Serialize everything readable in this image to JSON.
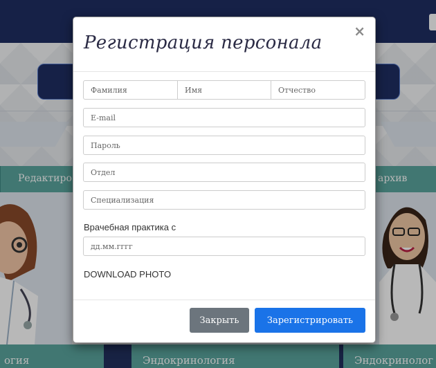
{
  "background": {
    "nav_left": "Редактиро",
    "nav_right": "архив",
    "footer_left": "огия",
    "footer_middle": "Эндокринология",
    "footer_right": "Эндокринолог"
  },
  "modal": {
    "title": "Регистрация персонала",
    "close_icon": "×",
    "fields": {
      "last_name_placeholder": "Фамилия",
      "first_name_placeholder": "Имя",
      "patronymic_placeholder": "Отчество",
      "email_placeholder": "E-mail",
      "password_placeholder": "Пароль",
      "department_placeholder": "Отдел",
      "specialization_placeholder": "Специализация",
      "practice_label": "Врачебная практика с",
      "practice_placeholder": "дд.мм.гггг"
    },
    "download_photo": "DOWNLOAD PHOTO",
    "buttons": {
      "close": "Закрыть",
      "register": "Зарегистрировать"
    }
  },
  "colors": {
    "navy": "#1f2f63",
    "teal": "#5aa59e",
    "close_button": "#6c757d",
    "primary_button": "#1a73e8"
  }
}
